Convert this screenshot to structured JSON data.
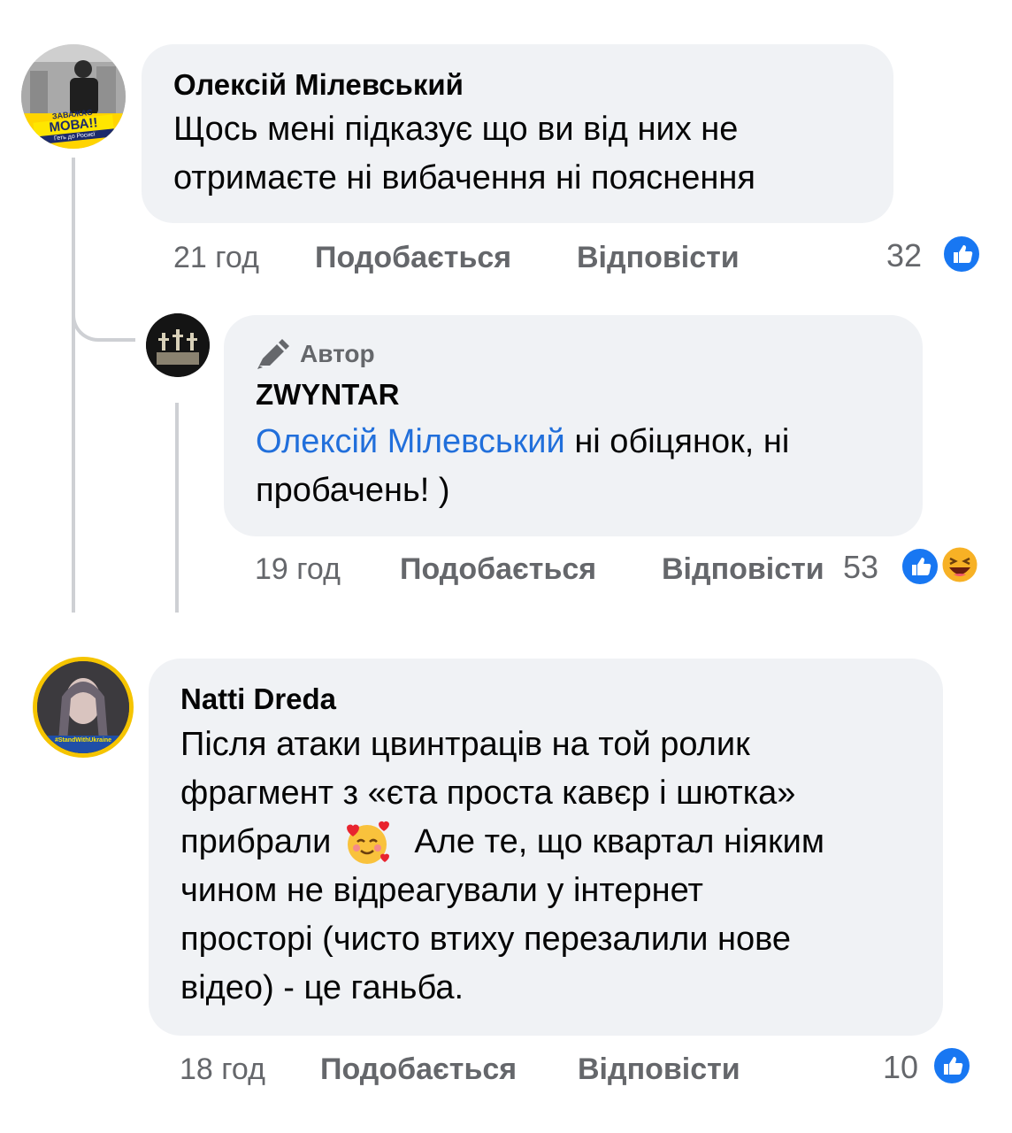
{
  "comments": [
    {
      "author": "Олексій Мілевський",
      "text_lines": [
        "Щось мені підказує що ви від них не",
        "отримаєте ні вибачення ні пояснення"
      ],
      "time": "21 год",
      "like_label": "Подобається",
      "reply_label": "Відповісти",
      "reaction_count": "32",
      "avatar_badge_top": "ЗАВАЖАЄ",
      "avatar_badge_main": "МОВА!!",
      "avatar_badge_sub": "Геть до Росиєї"
    },
    {
      "author_badge": "Автор",
      "author": "ZWYNTAR",
      "mention": "Олексій Мілевський",
      "text_after_mention": " ні обіцянок, ні",
      "text_line2": "пробачень! )",
      "time": "19 год",
      "like_label": "Подобається",
      "reply_label": "Відповісти",
      "reaction_count": "53"
    },
    {
      "author": "Natti Dreda",
      "text_lines": [
        "Після атаки цвинтраців на той ролик",
        "фрагмент з «єта проста кавєр і шютка»",
        "прибрали",
        "чином не відреагували у інтернет",
        "просторі (чисто втиху перезалили нове",
        "відео) - це ганьба."
      ],
      "line3_after_emoji": "Але те, що квартал ніяким",
      "time": "18 год",
      "like_label": "Подобається",
      "reply_label": "Відповісти",
      "reaction_count": "10",
      "avatar_badge": "#StandWithUkraine"
    }
  ],
  "colors": {
    "bubble": "#f0f2f5",
    "meta": "#65676b",
    "like_blue": "#1877f2",
    "mention": "#216fdb"
  },
  "icons": [
    "like-thumb-icon",
    "haha-emoji-icon",
    "pen-author-icon",
    "smiling-hearts-emoji-icon"
  ]
}
